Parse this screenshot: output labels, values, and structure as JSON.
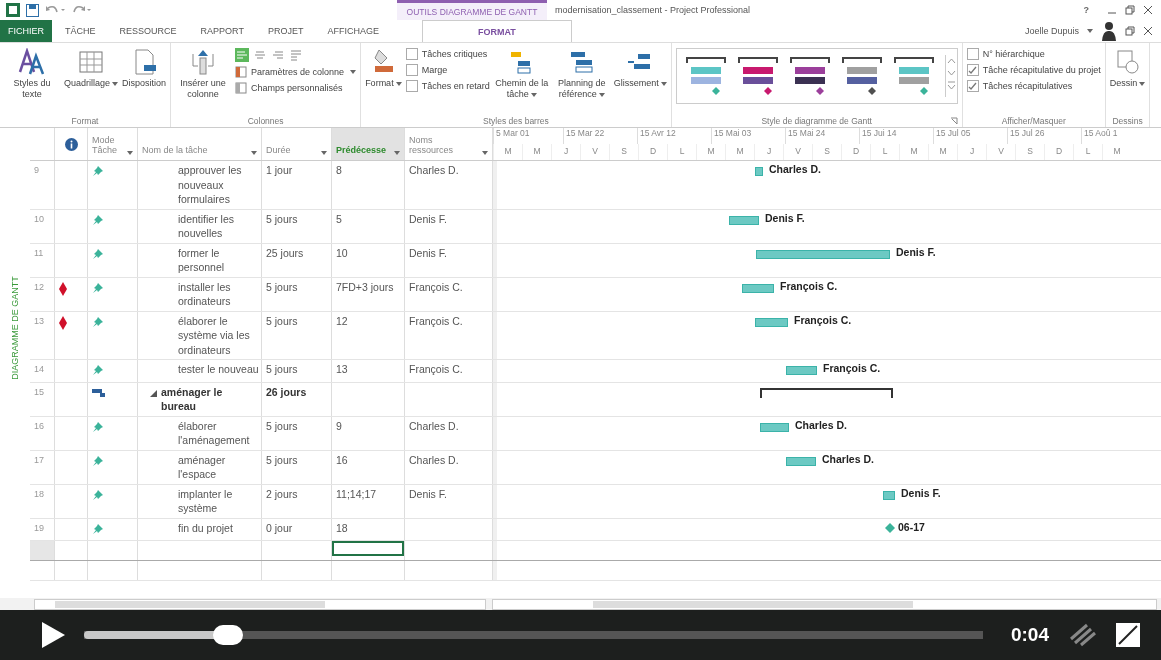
{
  "title_bar": {
    "contextual_label": "OUTILS DIAGRAMME DE GANTT",
    "title": "modernisation_classement - Project Professional",
    "help": "?"
  },
  "tabs": [
    {
      "label": "FICHIER",
      "kind": "file",
      "selected": false
    },
    {
      "label": "TÂCHE",
      "kind": "tab",
      "selected": false
    },
    {
      "label": "RESSOURCE",
      "kind": "tab",
      "selected": false
    },
    {
      "label": "RAPPORT",
      "kind": "tab",
      "selected": false
    },
    {
      "label": "PROJET",
      "kind": "tab",
      "selected": false
    },
    {
      "label": "AFFICHAGE",
      "kind": "tab",
      "selected": false
    },
    {
      "label": "FORMAT",
      "kind": "contextual",
      "selected": true
    }
  ],
  "user": "Joelle Dupuis",
  "ribbon": [
    {
      "label": "Format",
      "items": [
        {
          "kind": "large",
          "label": "Styles du texte",
          "menu": false
        },
        {
          "kind": "large",
          "label": "Quadrillage",
          "menu": true
        },
        {
          "kind": "large",
          "label": "Disposition",
          "menu": false
        }
      ]
    },
    {
      "label": "Colonnes",
      "items": [
        {
          "kind": "large",
          "label": "Insérer une colonne",
          "menu": false
        },
        {
          "kind": "stack",
          "items": [
            {
              "kind": "align"
            },
            {
              "kind": "small",
              "label": "Paramètres de colonne",
              "menu": true
            },
            {
              "kind": "small",
              "label": "Champs personnalisés",
              "menu": false
            }
          ]
        }
      ]
    },
    {
      "label": "Styles des barres",
      "items": [
        {
          "kind": "large",
          "label": "Format",
          "menu": true
        },
        {
          "kind": "stack",
          "items": [
            {
              "kind": "check",
              "label": "Tâches critiques",
              "checked": false
            },
            {
              "kind": "check",
              "label": "Marge",
              "checked": false
            },
            {
              "kind": "check",
              "label": "Tâches en retard",
              "checked": false
            }
          ]
        },
        {
          "kind": "large",
          "label": "Chemin de la tâche",
          "menu": true
        },
        {
          "kind": "large",
          "label": "Planning de référence",
          "menu": true
        },
        {
          "kind": "large",
          "label": "Glissement",
          "menu": true
        }
      ]
    },
    {
      "label": "Style de diagramme de Gantt",
      "items": [
        {
          "kind": "gallery",
          "swatches": [
            {
              "color": "#5cc5c5"
            },
            {
              "color": "#c8196e"
            },
            {
              "color": "#9b3f9b"
            },
            {
              "color": "#a0a0a0"
            },
            {
              "color": "#5cc5c5"
            }
          ]
        }
      ]
    },
    {
      "label": "Afficher/Masquer",
      "items": [
        {
          "kind": "stack",
          "items": [
            {
              "kind": "check",
              "label": "N° hiérarchique",
              "checked": false
            },
            {
              "kind": "check",
              "label": "Tâche récapitulative du projet",
              "checked": true
            },
            {
              "kind": "check",
              "label": "Tâches récapitulatives",
              "checked": true
            }
          ]
        }
      ]
    },
    {
      "label": "Dessins",
      "items": [
        {
          "kind": "large",
          "label": "Dessin",
          "menu": true
        }
      ]
    }
  ],
  "view_label": "DIAGRAMME DE GANTT",
  "table": {
    "columns": [
      {
        "kind": "info",
        "selected": false
      },
      {
        "kind": "mode",
        "label": "Mode Tâche",
        "selected": false
      },
      {
        "kind": "name",
        "label": "Nom de la tâche",
        "selected": false
      },
      {
        "kind": "duration",
        "label": "Durée",
        "selected": false
      },
      {
        "kind": "predecessors",
        "label": "Prédécesse",
        "selected": true
      },
      {
        "kind": "resources",
        "label": "Noms ressources",
        "selected": false
      }
    ],
    "rows": [
      {
        "id": "9",
        "flag": false,
        "kind": "task",
        "name": "approuver les nouveaux formulaires",
        "duration": "1 jour",
        "predecessors": "8",
        "resources": "Charles D."
      },
      {
        "id": "10",
        "flag": false,
        "kind": "task",
        "name": "identifier les nouvelles",
        "duration": "5 jours",
        "predecessors": "5",
        "resources": "Denis F."
      },
      {
        "id": "11",
        "flag": false,
        "kind": "task",
        "name": "former le personnel",
        "duration": "25 jours",
        "predecessors": "10",
        "resources": "Denis F."
      },
      {
        "id": "12",
        "flag": true,
        "kind": "task",
        "name": "installer les ordinateurs",
        "duration": "5 jours",
        "predecessors": "7FD+3 jours",
        "resources": "François C."
      },
      {
        "id": "13",
        "flag": true,
        "kind": "task",
        "name": "élaborer le système via les ordinateurs",
        "duration": "5 jours",
        "predecessors": "12",
        "resources": "François C."
      },
      {
        "id": "14",
        "flag": false,
        "kind": "task",
        "name": "tester le nouveau",
        "duration": "5 jours",
        "predecessors": "13",
        "resources": "François C."
      },
      {
        "id": "15",
        "flag": false,
        "kind": "summary",
        "name": "aménager le bureau",
        "duration": "26 jours",
        "expanded": true,
        "children": [
          {
            "id": "16",
            "flag": false,
            "kind": "task",
            "name": "élaborer l'aménagement",
            "duration": "5 jours",
            "predecessors": "9",
            "resources": "Charles D."
          },
          {
            "id": "17",
            "flag": false,
            "kind": "task",
            "name": "aménager l'espace",
            "duration": "5 jours",
            "predecessors": "16",
            "resources": "Charles D."
          },
          {
            "id": "18",
            "flag": false,
            "kind": "task",
            "name": "implanter le système",
            "duration": "2 jours",
            "predecessors": "11;14;17",
            "resources": "Denis F."
          },
          {
            "id": "19",
            "flag": false,
            "kind": "task",
            "name": "fin du projet",
            "duration": "0 jour",
            "predecessors": "18"
          }
        ]
      }
    ]
  },
  "gantt": {
    "timescale_top": [
      "5 Mar 01",
      "15 Mar 22",
      "15 Avr 12",
      "15 Mai 03",
      "15 Mai 24",
      "15 Jui 14",
      "15 Jul 05",
      "15 Jul 26",
      "15 Aoû 1"
    ],
    "timescale_bottom": [
      "M",
      "M",
      "J",
      "V",
      "S",
      "D",
      "L",
      "M",
      "M",
      "J",
      "V",
      "S",
      "D",
      "L",
      "M",
      "M",
      "J",
      "V",
      "S",
      "D",
      "L",
      "M"
    ],
    "bars": [
      {
        "kind": "task",
        "label": "Charles D."
      },
      {
        "kind": "task",
        "label": "Denis F."
      },
      {
        "kind": "task",
        "label": "Denis F."
      },
      {
        "kind": "task",
        "label": "François C."
      },
      {
        "kind": "task",
        "label": "François C."
      },
      {
        "kind": "task",
        "label": "François C."
      },
      {
        "kind": "summary"
      },
      {
        "kind": "task",
        "label": "Charles D."
      },
      {
        "kind": "task",
        "label": "Charles D."
      },
      {
        "kind": "task",
        "label": "Denis F."
      },
      {
        "kind": "milestone",
        "label": "06-17"
      }
    ]
  },
  "player": {
    "level": 0.16,
    "time": "0:04"
  }
}
